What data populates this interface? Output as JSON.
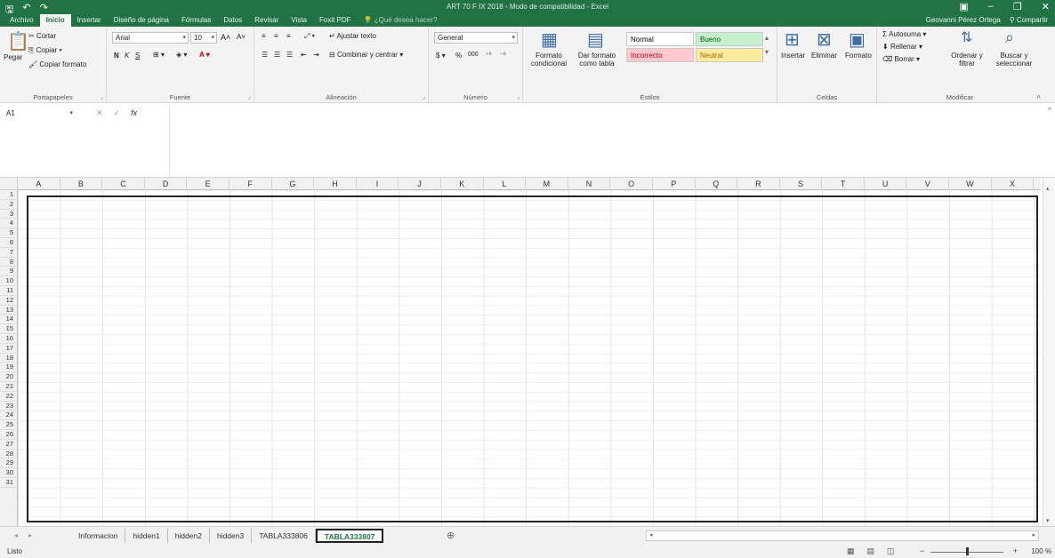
{
  "window": {
    "title": "ART 70 F IX 2018 - Modo de compatibilidad - Excel",
    "user": "Geovanni Pérez Ortega",
    "share_label": "Compartir"
  },
  "quick_access": {
    "save": "🖫",
    "undo": "↶",
    "redo": "↷"
  },
  "tabs": [
    "Archivo",
    "Inicio",
    "Insertar",
    "Diseño de página",
    "Fórmulas",
    "Datos",
    "Revisar",
    "Vista",
    "Foxit PDF"
  ],
  "active_tab": "Inicio",
  "tell_me_placeholder": "¿Qué desea hacer?",
  "ribbon": {
    "portapapeles": {
      "label": "Portapapeles",
      "pegar": "Pegar",
      "cortar": "Cortar",
      "copiar": "Copiar",
      "copiar_formato": "Copiar formato"
    },
    "fuente": {
      "label": "Fuente",
      "font_name": "Arial",
      "font_size": "10",
      "bold": "N",
      "italic": "K",
      "underline": "S"
    },
    "alineacion": {
      "label": "Alineación",
      "ajustar_texto": "Ajustar texto",
      "combinar": "Combinar y centrar"
    },
    "numero": {
      "label": "Número",
      "format": "General",
      "currency": "$",
      "percent": "%",
      "thousands": "000"
    },
    "estilos": {
      "label": "Estilos",
      "formato_condicional": "Formato condicional",
      "dar_formato_tabla": "Dar formato como tabla",
      "cells": [
        {
          "name": "Normal",
          "bg": "#ffffff",
          "fg": "#000000"
        },
        {
          "name": "Bueno",
          "bg": "#c6efce",
          "fg": "#006100"
        },
        {
          "name": "Incorrecto",
          "bg": "#ffc7ce",
          "fg": "#9c0006"
        },
        {
          "name": "Neutral",
          "bg": "#ffeb9c",
          "fg": "#9c6500"
        }
      ]
    },
    "celdas": {
      "label": "Celdas",
      "insertar": "Insertar",
      "eliminar": "Eliminar",
      "formato": "Formato"
    },
    "modificar": {
      "label": "Modificar",
      "autosuma": "Autosuma",
      "rellenar": "Rellenar",
      "borrar": "Borrar",
      "ordenar": "Ordenar y filtrar",
      "buscar": "Buscar y seleccionar"
    }
  },
  "formula_bar": {
    "name_box": "A1",
    "fx": "fx",
    "value": ""
  },
  "columns": [
    "A",
    "B",
    "C",
    "D",
    "E",
    "F",
    "G",
    "H",
    "I",
    "J",
    "K",
    "L",
    "M",
    "N",
    "O",
    "P",
    "Q",
    "R",
    "S",
    "T",
    "U",
    "V",
    "W",
    "X"
  ],
  "rows": [
    "1",
    "2",
    "3",
    "4",
    "5",
    "6",
    "7",
    "8",
    "9",
    "10",
    "11",
    "12",
    "13",
    "14",
    "15",
    "16",
    "17",
    "18",
    "19",
    "20",
    "21",
    "22",
    "23",
    "24",
    "25",
    "26",
    "27",
    "28",
    "29",
    "30",
    "31"
  ],
  "sheets": [
    "Informacion",
    "hidden1",
    "hidden2",
    "hidden3",
    "TABLA333806",
    "TABLA333807"
  ],
  "active_sheet": "TABLA333807",
  "status": {
    "text": "Listo",
    "zoom": "100 %",
    "zoom_level": 1.0
  },
  "colors": {
    "accent": "#217346"
  }
}
